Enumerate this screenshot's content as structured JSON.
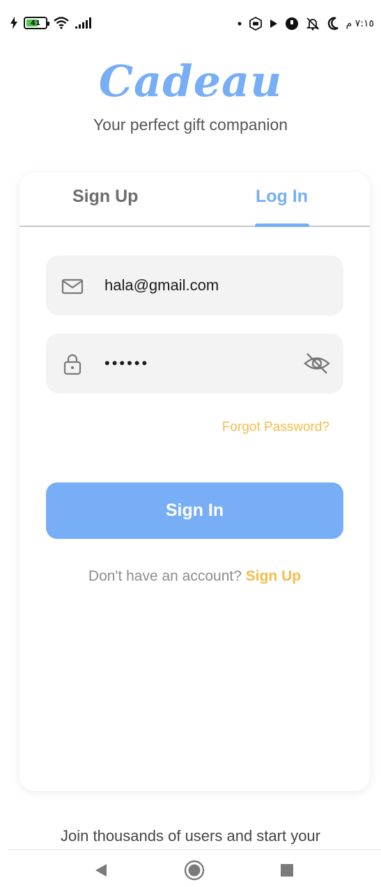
{
  "status_bar": {
    "battery_level": "41",
    "time": "٧:١٥ م",
    "icons": [
      "charging-icon",
      "battery-icon",
      "wifi-icon",
      "signal-icon",
      "dot-icon",
      "mi-icon",
      "play-icon",
      "circle-app-icon",
      "bell-off-icon",
      "moon-icon"
    ]
  },
  "app": {
    "logo": "Cadeau",
    "tagline": "Your perfect gift companion"
  },
  "tabs": {
    "signup_label": "Sign Up",
    "login_label": "Log In",
    "active": "Log In"
  },
  "form": {
    "email_value": "hala@gmail.com",
    "password_value": "••••••",
    "forgot_label": "Forgot Password?",
    "signin_label": "Sign In",
    "no_account_text": "Don't have an account?",
    "signup_link": "Sign Up"
  },
  "footer": {
    "join_text": "Join thousands of users and start your"
  },
  "colors": {
    "accent": "#77aef6",
    "link": "#f5bc48",
    "field_bg": "#f3f3f3"
  }
}
